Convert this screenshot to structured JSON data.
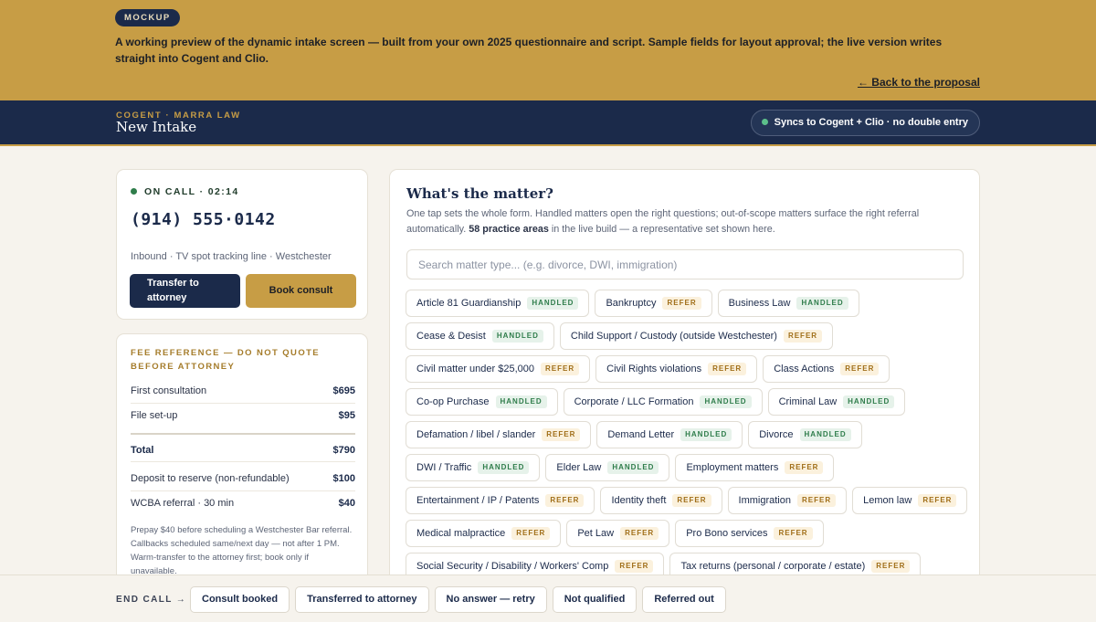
{
  "banner": {
    "badge": "MOCKUP",
    "text": "A working preview of the dynamic intake screen — built from your own 2025 questionnaire and script. Sample fields for layout approval; the live version writes straight into Cogent and Clio.",
    "back_link": "← Back to the proposal"
  },
  "nav": {
    "eyebrow": "COGENT · MARRA LAW",
    "title": "New Intake",
    "sync": "Syncs to Cogent + Clio · no double entry"
  },
  "call": {
    "status": "ON CALL · 02:14",
    "phone": "(914) 555·0142",
    "meta": "Inbound · TV spot tracking line · Westchester",
    "transfer_label": "Transfer to attorney",
    "book_label": "Book consult"
  },
  "fees": {
    "heading": "FEE REFERENCE — DO NOT QUOTE BEFORE ATTORNEY",
    "rows": [
      {
        "label": "First consultation",
        "amount": "$695"
      },
      {
        "label": "File set-up",
        "amount": "$95"
      },
      {
        "label": "Total",
        "amount": "$790"
      },
      {
        "label": "Deposit to reserve (non-refundable)",
        "amount": "$100"
      },
      {
        "label": "WCBA referral · 30 min",
        "amount": "$40"
      }
    ],
    "note": "Prepay $40 before scheduling a Westchester Bar referral. Callbacks scheduled same/next day — not after 1 PM. Warm-transfer to the attorney first; book only if unavailable."
  },
  "matter": {
    "title": "What's the matter?",
    "desc_1": "One tap sets the whole form. Handled matters open the right questions; out-of-scope matters surface the right referral automatically. ",
    "desc_bold": "58 practice areas",
    "desc_2": " in the live build — a representative set shown here.",
    "search_placeholder": "Search matter type... (e.g. divorce, DWI, immigration)",
    "chips": [
      {
        "label": "Article 81 Guardianship",
        "tag": "HANDLED",
        "kind": "handled"
      },
      {
        "label": "Bankruptcy",
        "tag": "REFER",
        "kind": "refer"
      },
      {
        "label": "Business Law",
        "tag": "HANDLED",
        "kind": "handled"
      },
      {
        "label": "Cease & Desist",
        "tag": "HANDLED",
        "kind": "handled"
      },
      {
        "label": "Child Support / Custody (outside Westchester)",
        "tag": "REFER",
        "kind": "refer"
      },
      {
        "label": "Civil matter under $25,000",
        "tag": "REFER",
        "kind": "refer"
      },
      {
        "label": "Civil Rights violations",
        "tag": "REFER",
        "kind": "refer"
      },
      {
        "label": "Class Actions",
        "tag": "REFER",
        "kind": "refer"
      },
      {
        "label": "Co-op Purchase",
        "tag": "HANDLED",
        "kind": "handled"
      },
      {
        "label": "Corporate / LLC Formation",
        "tag": "HANDLED",
        "kind": "handled"
      },
      {
        "label": "Criminal Law",
        "tag": "HANDLED",
        "kind": "handled"
      },
      {
        "label": "Defamation / libel / slander",
        "tag": "REFER",
        "kind": "refer"
      },
      {
        "label": "Demand Letter",
        "tag": "HANDLED",
        "kind": "handled"
      },
      {
        "label": "Divorce",
        "tag": "HANDLED",
        "kind": "handled"
      },
      {
        "label": "DWI / Traffic",
        "tag": "HANDLED",
        "kind": "handled"
      },
      {
        "label": "Elder Law",
        "tag": "HANDLED",
        "kind": "handled"
      },
      {
        "label": "Employment matters",
        "tag": "REFER",
        "kind": "refer"
      },
      {
        "label": "Entertainment / IP / Patents",
        "tag": "REFER",
        "kind": "refer"
      },
      {
        "label": "Identity theft",
        "tag": "REFER",
        "kind": "refer"
      },
      {
        "label": "Immigration",
        "tag": "REFER",
        "kind": "refer"
      },
      {
        "label": "Lemon law",
        "tag": "REFER",
        "kind": "refer"
      },
      {
        "label": "Medical malpractice",
        "tag": "REFER",
        "kind": "refer"
      },
      {
        "label": "Pet Law",
        "tag": "REFER",
        "kind": "refer"
      },
      {
        "label": "Pro Bono services",
        "tag": "REFER",
        "kind": "refer"
      },
      {
        "label": "Social Security / Disability / Workers' Comp",
        "tag": "REFER",
        "kind": "refer"
      },
      {
        "label": "Tax returns (personal / corporate / estate)",
        "tag": "REFER",
        "kind": "refer"
      }
    ]
  },
  "footer": {
    "end_label": "END CALL →",
    "outcomes": [
      "Consult booked",
      "Transferred to attorney",
      "No answer — retry",
      "Not qualified",
      "Referred out"
    ]
  },
  "colors": {
    "gold": "#c79d45",
    "navy": "#1b2a4a",
    "handled_green": "#2f7d4b",
    "refer_amber": "#a06e18",
    "live_dot": "#5cc08b"
  }
}
